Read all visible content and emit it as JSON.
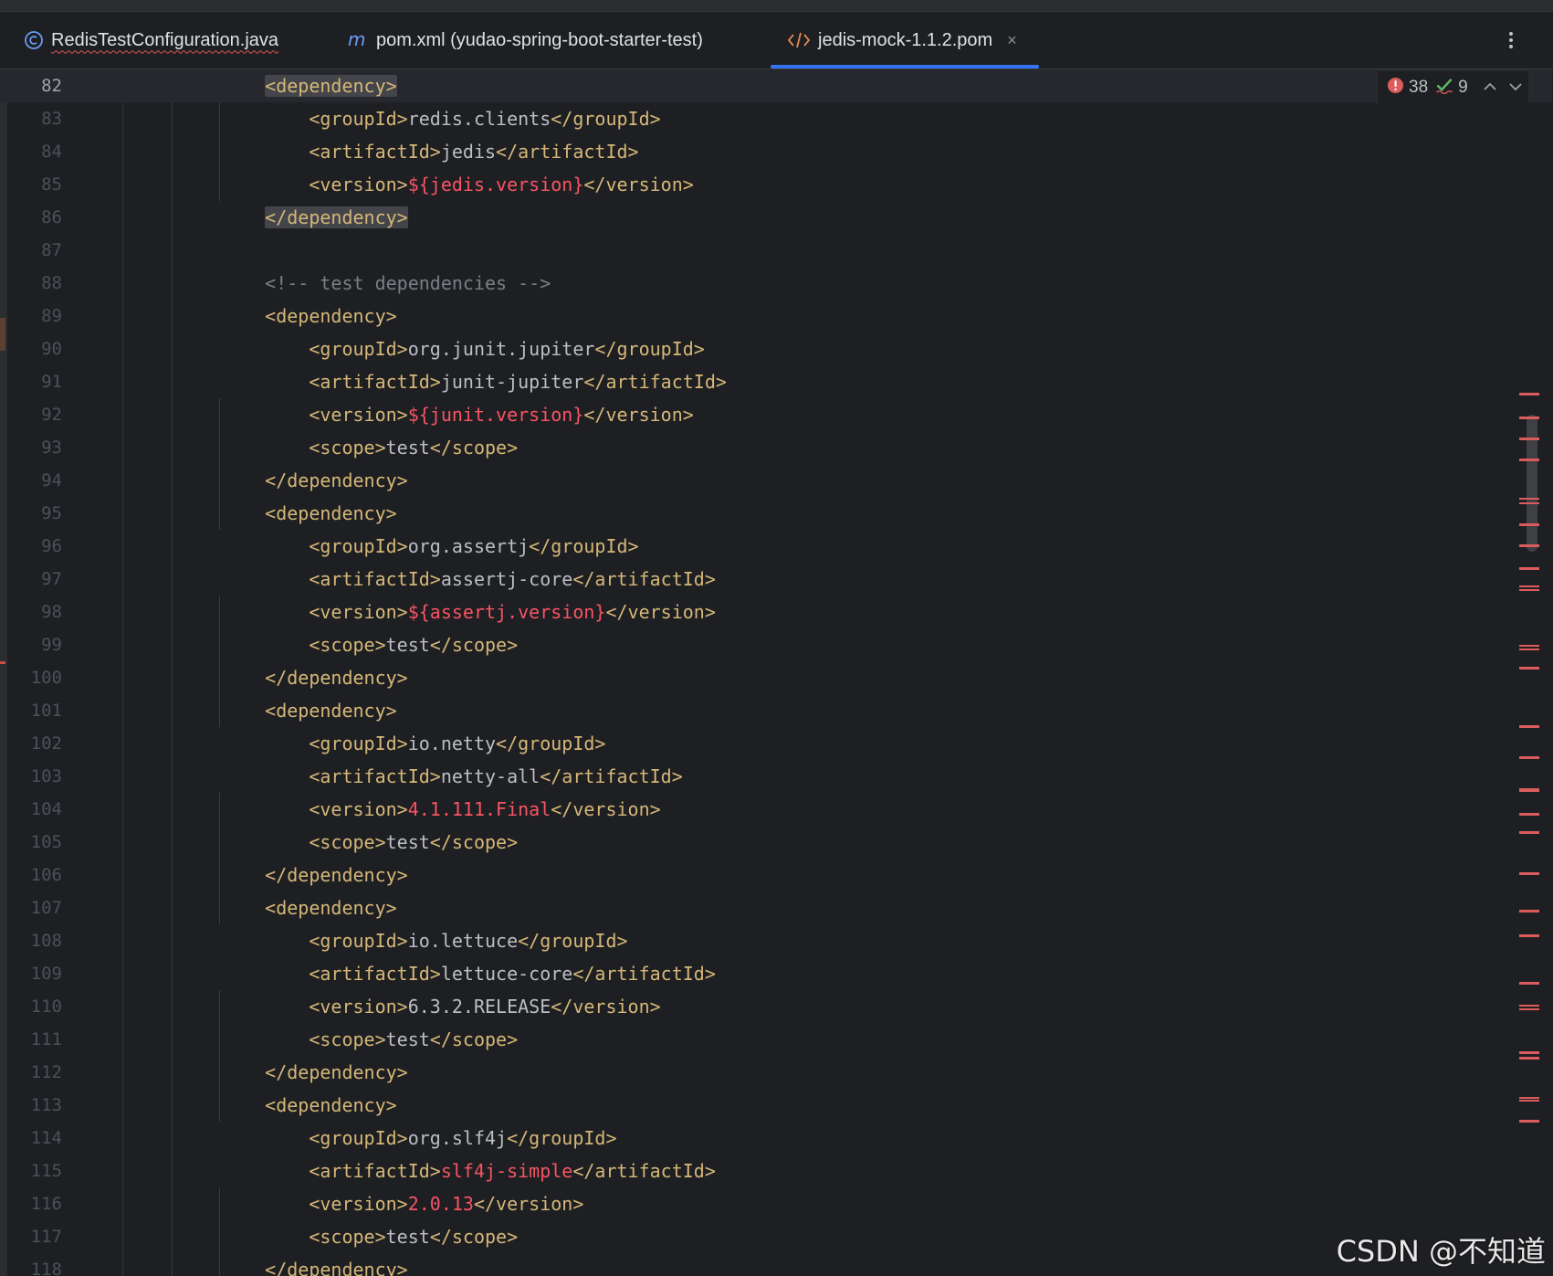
{
  "tabs": [
    {
      "label": "RedisTestConfiguration.java",
      "icon": "class-icon"
    },
    {
      "label": "pom.xml (yudao-spring-boot-starter-test)",
      "icon": "maven-icon"
    },
    {
      "label": "jedis-mock-1.1.2.pom",
      "icon": "xml-icon",
      "active": true,
      "close": "×"
    }
  ],
  "inspection": {
    "errors": "38",
    "warnings": "9"
  },
  "colors": {
    "tag": "#d5b778",
    "text": "#bcbec4",
    "value_red": "#f75464",
    "comment": "#7a7e85",
    "accent": "#3574f0",
    "error": "#db5c5c"
  },
  "lines": [
    {
      "n": "82",
      "current": true,
      "segs": [
        [
          "    ",
          "txt"
        ],
        [
          "<dependency>",
          "tag hl"
        ]
      ]
    },
    {
      "n": "83",
      "segs": [
        [
          "        ",
          "txt"
        ],
        [
          "<groupId>",
          "tag"
        ],
        [
          "redis.clients",
          "txt"
        ],
        [
          "</groupId>",
          "tag"
        ]
      ]
    },
    {
      "n": "84",
      "segs": [
        [
          "        ",
          "txt"
        ],
        [
          "<artifactId>",
          "tag"
        ],
        [
          "jedis",
          "txt"
        ],
        [
          "</artifactId>",
          "tag"
        ]
      ]
    },
    {
      "n": "85",
      "segs": [
        [
          "        ",
          "txt"
        ],
        [
          "<version>",
          "tag"
        ],
        [
          "${jedis.version}",
          "red"
        ],
        [
          "</version>",
          "tag"
        ]
      ]
    },
    {
      "n": "86",
      "segs": [
        [
          "    ",
          "txt"
        ],
        [
          "</dependency>",
          "tag hl"
        ]
      ]
    },
    {
      "n": "87",
      "segs": []
    },
    {
      "n": "88",
      "segs": [
        [
          "    ",
          "txt"
        ],
        [
          "<!-- test dependencies -->",
          "cmt"
        ]
      ]
    },
    {
      "n": "89",
      "segs": [
        [
          "    ",
          "txt"
        ],
        [
          "<dependency>",
          "tag"
        ]
      ]
    },
    {
      "n": "90",
      "segs": [
        [
          "        ",
          "txt"
        ],
        [
          "<groupId>",
          "tag"
        ],
        [
          "org.junit.jupiter",
          "txt"
        ],
        [
          "</groupId>",
          "tag"
        ]
      ]
    },
    {
      "n": "91",
      "segs": [
        [
          "        ",
          "txt"
        ],
        [
          "<artifactId>",
          "tag"
        ],
        [
          "junit-jupiter",
          "txt"
        ],
        [
          "</artifactId>",
          "tag"
        ]
      ]
    },
    {
      "n": "92",
      "segs": [
        [
          "        ",
          "txt"
        ],
        [
          "<version>",
          "tag"
        ],
        [
          "${junit.version}",
          "red"
        ],
        [
          "</version>",
          "tag"
        ]
      ]
    },
    {
      "n": "93",
      "segs": [
        [
          "        ",
          "txt"
        ],
        [
          "<scope>",
          "tag"
        ],
        [
          "test",
          "txt"
        ],
        [
          "</scope>",
          "tag"
        ]
      ]
    },
    {
      "n": "94",
      "segs": [
        [
          "    ",
          "txt"
        ],
        [
          "</dependency>",
          "tag"
        ]
      ]
    },
    {
      "n": "95",
      "segs": [
        [
          "    ",
          "txt"
        ],
        [
          "<dependency>",
          "tag"
        ]
      ]
    },
    {
      "n": "96",
      "segs": [
        [
          "        ",
          "txt"
        ],
        [
          "<groupId>",
          "tag"
        ],
        [
          "org.assertj",
          "txt"
        ],
        [
          "</groupId>",
          "tag"
        ]
      ]
    },
    {
      "n": "97",
      "segs": [
        [
          "        ",
          "txt"
        ],
        [
          "<artifactId>",
          "tag"
        ],
        [
          "assertj-core",
          "txt"
        ],
        [
          "</artifactId>",
          "tag"
        ]
      ]
    },
    {
      "n": "98",
      "segs": [
        [
          "        ",
          "txt"
        ],
        [
          "<version>",
          "tag"
        ],
        [
          "${assertj.version}",
          "red"
        ],
        [
          "</version>",
          "tag"
        ]
      ]
    },
    {
      "n": "99",
      "segs": [
        [
          "        ",
          "txt"
        ],
        [
          "<scope>",
          "tag"
        ],
        [
          "test",
          "txt"
        ],
        [
          "</scope>",
          "tag"
        ]
      ]
    },
    {
      "n": "100",
      "segs": [
        [
          "    ",
          "txt"
        ],
        [
          "</dependency>",
          "tag"
        ]
      ]
    },
    {
      "n": "101",
      "segs": [
        [
          "    ",
          "txt"
        ],
        [
          "<dependency>",
          "tag"
        ]
      ]
    },
    {
      "n": "102",
      "segs": [
        [
          "        ",
          "txt"
        ],
        [
          "<groupId>",
          "tag"
        ],
        [
          "io.netty",
          "txt"
        ],
        [
          "</groupId>",
          "tag"
        ]
      ]
    },
    {
      "n": "103",
      "segs": [
        [
          "        ",
          "txt"
        ],
        [
          "<artifactId>",
          "tag"
        ],
        [
          "netty-all",
          "txt"
        ],
        [
          "</artifactId>",
          "tag"
        ]
      ]
    },
    {
      "n": "104",
      "segs": [
        [
          "        ",
          "txt"
        ],
        [
          "<version>",
          "tag"
        ],
        [
          "4.1.111.Final",
          "red"
        ],
        [
          "</version>",
          "tag"
        ]
      ]
    },
    {
      "n": "105",
      "segs": [
        [
          "        ",
          "txt"
        ],
        [
          "<scope>",
          "tag"
        ],
        [
          "test",
          "txt"
        ],
        [
          "</scope>",
          "tag"
        ]
      ]
    },
    {
      "n": "106",
      "segs": [
        [
          "    ",
          "txt"
        ],
        [
          "</dependency>",
          "tag"
        ]
      ]
    },
    {
      "n": "107",
      "segs": [
        [
          "    ",
          "txt"
        ],
        [
          "<dependency>",
          "tag"
        ]
      ]
    },
    {
      "n": "108",
      "segs": [
        [
          "        ",
          "txt"
        ],
        [
          "<groupId>",
          "tag"
        ],
        [
          "io.lettuce",
          "txt"
        ],
        [
          "</groupId>",
          "tag"
        ]
      ]
    },
    {
      "n": "109",
      "segs": [
        [
          "        ",
          "txt"
        ],
        [
          "<artifactId>",
          "tag"
        ],
        [
          "lettuce-core",
          "txt"
        ],
        [
          "</artifactId>",
          "tag"
        ]
      ]
    },
    {
      "n": "110",
      "segs": [
        [
          "        ",
          "txt"
        ],
        [
          "<version>",
          "tag"
        ],
        [
          "6.3.2.RELEASE",
          "txt"
        ],
        [
          "</version>",
          "tag"
        ]
      ]
    },
    {
      "n": "111",
      "segs": [
        [
          "        ",
          "txt"
        ],
        [
          "<scope>",
          "tag"
        ],
        [
          "test",
          "txt"
        ],
        [
          "</scope>",
          "tag"
        ]
      ]
    },
    {
      "n": "112",
      "segs": [
        [
          "    ",
          "txt"
        ],
        [
          "</dependency>",
          "tag"
        ]
      ]
    },
    {
      "n": "113",
      "segs": [
        [
          "    ",
          "txt"
        ],
        [
          "<dependency>",
          "tag"
        ]
      ]
    },
    {
      "n": "114",
      "segs": [
        [
          "        ",
          "txt"
        ],
        [
          "<groupId>",
          "tag"
        ],
        [
          "org.slf4j",
          "txt"
        ],
        [
          "</groupId>",
          "tag"
        ]
      ]
    },
    {
      "n": "115",
      "segs": [
        [
          "        ",
          "txt"
        ],
        [
          "<artifactId>",
          "tag"
        ],
        [
          "slf4j-simple",
          "red"
        ],
        [
          "</artifactId>",
          "tag"
        ]
      ]
    },
    {
      "n": "116",
      "segs": [
        [
          "        ",
          "txt"
        ],
        [
          "<version>",
          "tag"
        ],
        [
          "2.0.13",
          "red"
        ],
        [
          "</version>",
          "tag"
        ]
      ]
    },
    {
      "n": "117",
      "segs": [
        [
          "        ",
          "txt"
        ],
        [
          "<scope>",
          "tag"
        ],
        [
          "test",
          "txt"
        ],
        [
          "</scope>",
          "tag"
        ]
      ]
    },
    {
      "n": "118",
      "segs": [
        [
          "    ",
          "txt"
        ],
        [
          "</dependency>",
          "tag"
        ]
      ]
    }
  ],
  "watermark": "CSDN @不知道"
}
